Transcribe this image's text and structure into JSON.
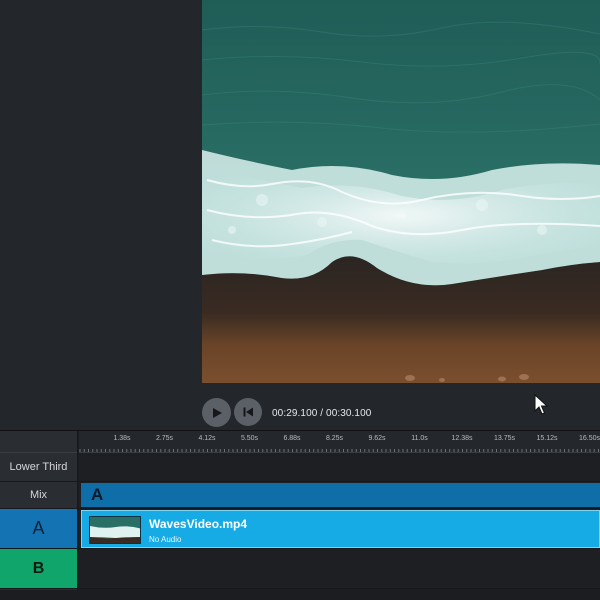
{
  "player": {
    "current_time": "00:29.100",
    "separator": " / ",
    "total_time": "00:30.100",
    "play_icon": "play-icon",
    "restart_icon": "skip-back-icon"
  },
  "timeline": {
    "ruler_ticks": [
      "1.38s",
      "2.75s",
      "4.12s",
      "5.50s",
      "6.88s",
      "8.25s",
      "9.62s",
      "11.0s",
      "12.38s",
      "13.75s",
      "15.12s",
      "16.50s"
    ],
    "tracks": {
      "lower_third": "Lower Third",
      "mix": "Mix",
      "a": "A",
      "b": "B"
    },
    "mix_clip_label": "A",
    "video_clip": {
      "name": "WavesVideo.mp4",
      "audio_status": "No Audio"
    }
  },
  "colors": {
    "track_a": "#1474b3",
    "track_b": "#10a56b",
    "clip": "#17abe6",
    "mix_clip": "#0f6ea8"
  }
}
